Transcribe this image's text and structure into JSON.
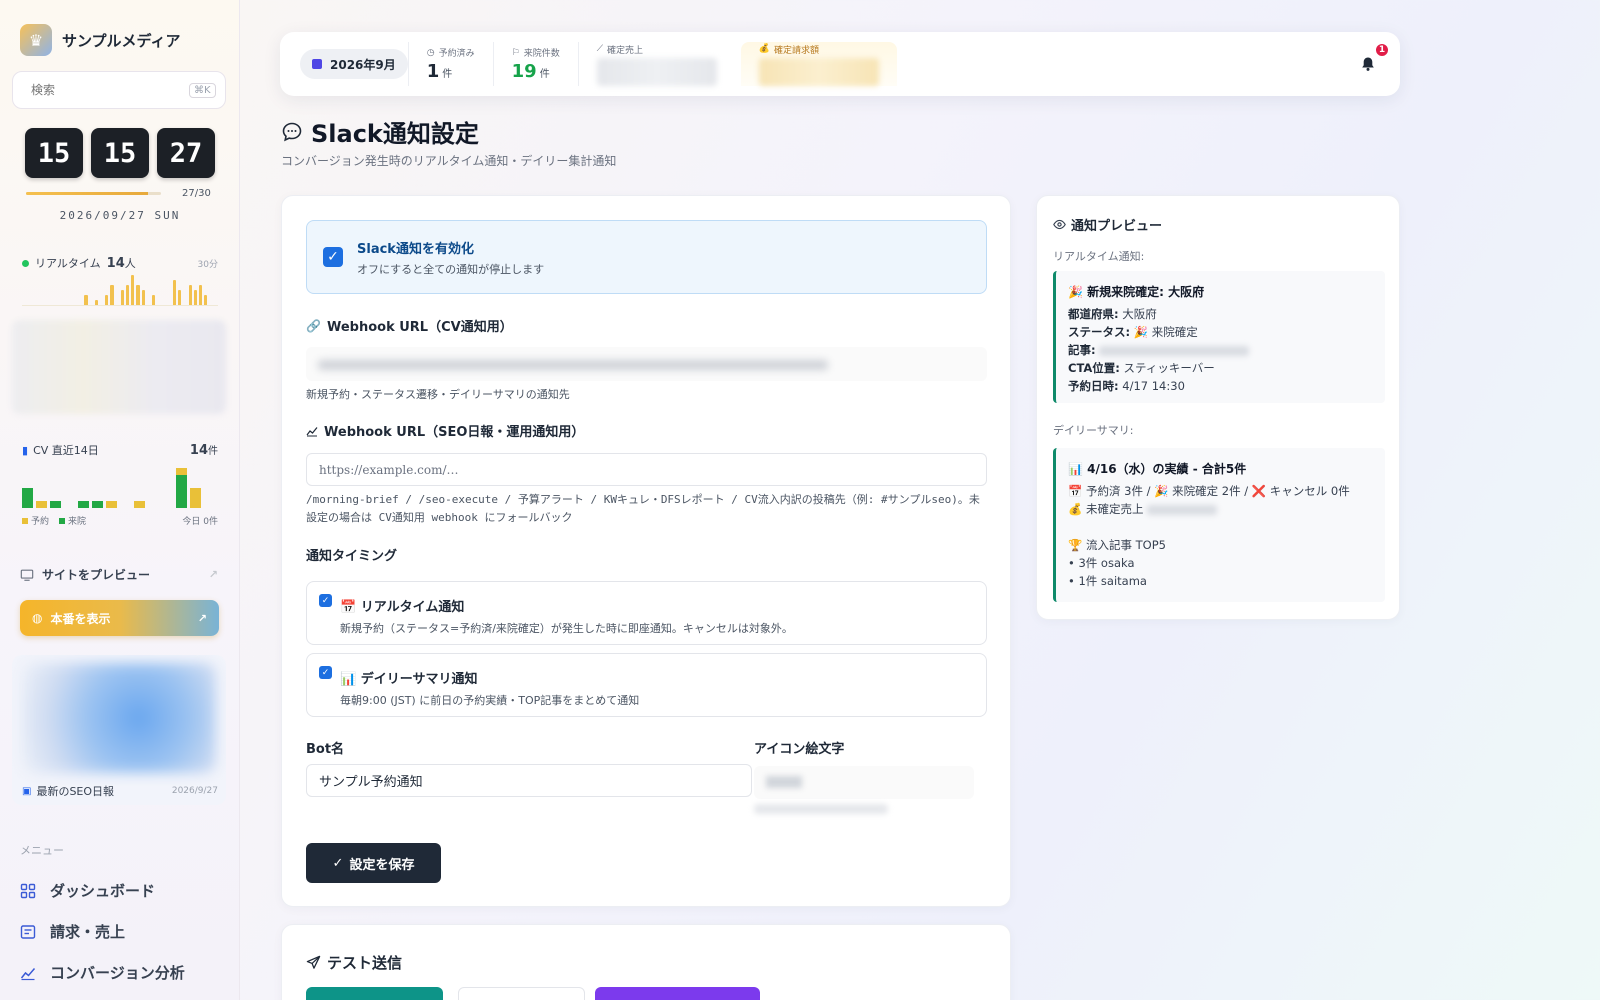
{
  "brand": {
    "name": "サンプルメディア"
  },
  "search": {
    "placeholder": "検索",
    "shortcut": "⌘K"
  },
  "clock": {
    "hours": "15",
    "minutes": "15",
    "seconds": "27",
    "day_progress": "27/30",
    "day_fraction": 0.9,
    "date": "2026/09/27 SUN"
  },
  "realtime": {
    "label": "リアルタイム",
    "count": "14",
    "unit": "人",
    "window": "30分",
    "bars": [
      0,
      0,
      0,
      0,
      0,
      0,
      0,
      0,
      0,
      0,
      0,
      0,
      2,
      0,
      1,
      0,
      2,
      4,
      0,
      3,
      4,
      6,
      4,
      3,
      0,
      2,
      0,
      0,
      0,
      5,
      3,
      0,
      4,
      3,
      4,
      2,
      0,
      0
    ]
  },
  "cv": {
    "label": "CV 直近14日",
    "total": "14",
    "unit": "件",
    "legend_booked": "予約",
    "legend_visited": "来院",
    "today": "今日 0件",
    "days": [
      {
        "b": 0,
        "v": 3
      },
      {
        "b": 1,
        "v": 0
      },
      {
        "b": 0,
        "v": 1
      },
      {
        "b": 0,
        "v": 0
      },
      {
        "b": 0,
        "v": 1
      },
      {
        "b": 0,
        "v": 1
      },
      {
        "b": 1,
        "v": 0
      },
      {
        "b": 0,
        "v": 0
      },
      {
        "b": 1,
        "v": 0
      },
      {
        "b": 0,
        "v": 0
      },
      {
        "b": 0,
        "v": 0
      },
      {
        "b": 1,
        "v": 5
      },
      {
        "b": 3,
        "v": 0
      },
      {
        "b": 0,
        "v": 0
      }
    ]
  },
  "sidebar_links": {
    "preview": "サイトをプレビュー",
    "production": "本番を表示"
  },
  "seo_report": {
    "caption": "最新のSEO日報",
    "date": "2026/9/27"
  },
  "menu": {
    "label": "メニュー",
    "items": [
      {
        "label": "ダッシュボード"
      },
      {
        "label": "請求・売上"
      },
      {
        "label": "コンバージョン分析"
      }
    ]
  },
  "statbar": {
    "month": "2026年9月",
    "booked": {
      "label": "予約済み",
      "value": "1",
      "unit": "件"
    },
    "visits": {
      "label": "来院件数",
      "value": "19",
      "unit": "件"
    },
    "sales": {
      "label": "確定売上"
    },
    "billing": {
      "label": "確定請求額"
    },
    "notifications": "1"
  },
  "page": {
    "title": "Slack通知設定",
    "subtitle": "コンバージョン発生時のリアルタイム通知・デイリー集計通知"
  },
  "settings": {
    "enable_title": "Slack通知を有効化",
    "enable_desc": "オフにすると全ての通知が停止します",
    "webhook_cv_label": "Webhook URL（CV通知用）",
    "webhook_cv_hint": "新規予約・ステータス遷移・デイリーサマリの通知先",
    "webhook_seo_label": "Webhook URL（SEO日報・運用通知用）",
    "webhook_seo_placeholder": "https://example.com/…",
    "webhook_seo_hint": "/morning-brief / /seo-execute / 予算アラート / KWキュレ・DFSレポート / CV流入内訳の投稿先（例: #サンプルseo)。未設定の場合は CV通知用 webhook にフォールバック",
    "timing_label": "通知タイミング",
    "realtime_title": "📅 リアルタイム通知",
    "realtime_desc": "新規予約（ステータス=予約済/来院確定）が発生した時に即座通知。キャンセルは対象外。",
    "daily_title": "📊 デイリーサマリ通知",
    "daily_desc": "毎朝9:00 (JST) に前日の予約実績・TOP記事をまとめて通知",
    "bot_label": "Bot名",
    "bot_value": "サンプル予約通知",
    "emoji_label": "アイコン絵文字",
    "save_label": "設定を保存"
  },
  "test": {
    "title": "テスト送信"
  },
  "preview": {
    "title": "通知プレビュー",
    "realtime_label": "リアルタイム通知:",
    "rt_title": "🎉 新規来院確定: 大阪府",
    "rt_pref_k": "都道府県:",
    "rt_pref_v": "大阪府",
    "rt_status_k": "ステータス:",
    "rt_status_v": "🎉 来院確定",
    "rt_article_k": "記事:",
    "rt_cta_k": "CTA位置:",
    "rt_cta_v": "スティッキーバー",
    "rt_date_k": "予約日時:",
    "rt_date_v": "4/17 14:30",
    "daily_label": "デイリーサマリ:",
    "d_title": "📊 4/16（水）の実績 - 合計5件",
    "d_line1": "📅 予約済 3件 / 🎉 来院確定 2件 / ❌ キャンセル 0件",
    "d_line2": "💰 未確定売上",
    "d_top": "🏆 流入記事 TOP5",
    "d_item1": "• 3件 osaka",
    "d_item2": "• 1件 saitama"
  },
  "colors": {
    "accent": "#1d6fe0",
    "dark": "#1f2937",
    "green": "#16a34a",
    "slack_border": "#0f8a6a"
  }
}
